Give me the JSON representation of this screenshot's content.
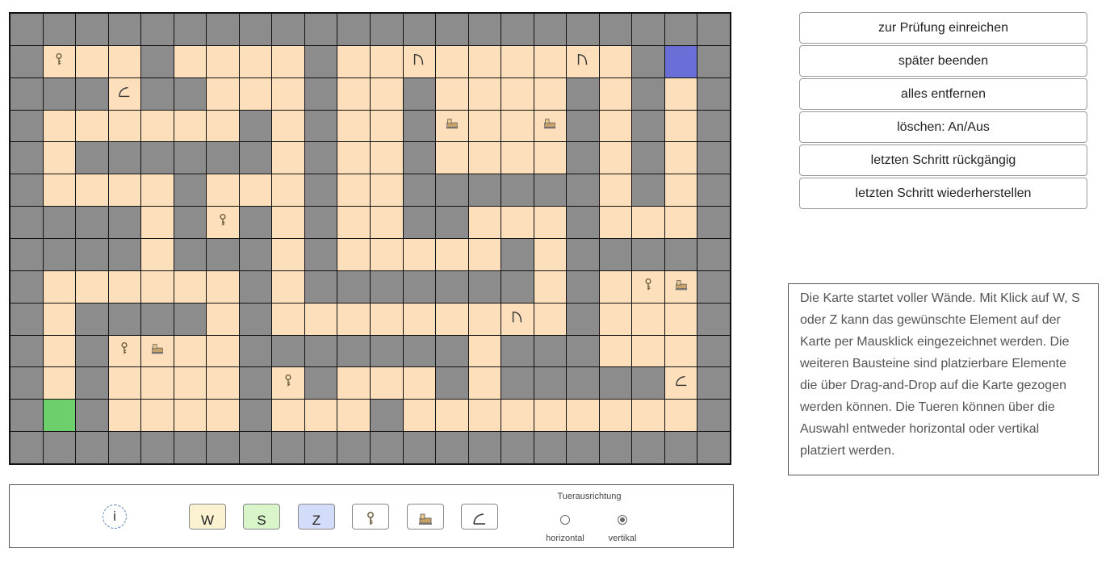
{
  "map": {
    "rows": [
      "WWWWWWWWWWWWWWWWWWWWWW",
      "WFFFWFFFFWFFFFFFFFFWZW",
      "WWWFWWFFFWFFWFFFFWFWFW",
      "WFFFFFFWFWFFWFFFFWFWFW",
      "WFWWWWWWFWFFWFFFFWFWFW",
      "WFFFFWFFFWFFWWWWWWFWFW",
      "WWWWFWFWFWFFWWFFFWFFFW",
      "WWWWFWWWFWFFFFFWFWWWWW",
      "WFFFFFFWFWWWWWWWFWFFFW",
      "WFWWWWFWFFFFFFFFFWFFFW",
      "WFWFFFFWWWWWWWFWWWFFFW",
      "WFWFFFFWFWFFFWFWWWWWFW",
      "WSWFFFFWFFFWFFFFFFFFFW",
      "WWWWWWWWWWWWWWWWWWWWWW"
    ],
    "items": [
      {
        "row": 1,
        "col": 1,
        "icon": "key-icon"
      },
      {
        "row": 1,
        "col": 12,
        "icon": "door-icon"
      },
      {
        "row": 1,
        "col": 17,
        "icon": "door-icon"
      },
      {
        "row": 2,
        "col": 3,
        "icon": "trap-icon"
      },
      {
        "row": 3,
        "col": 13,
        "icon": "sphinx-icon"
      },
      {
        "row": 3,
        "col": 16,
        "icon": "sphinx-icon"
      },
      {
        "row": 6,
        "col": 6,
        "icon": "key-icon"
      },
      {
        "row": 8,
        "col": 19,
        "icon": "key-icon"
      },
      {
        "row": 8,
        "col": 20,
        "icon": "sphinx-icon"
      },
      {
        "row": 9,
        "col": 15,
        "icon": "door-icon"
      },
      {
        "row": 10,
        "col": 3,
        "icon": "key-icon"
      },
      {
        "row": 10,
        "col": 4,
        "icon": "sphinx-icon"
      },
      {
        "row": 11,
        "col": 8,
        "icon": "key-icon"
      },
      {
        "row": 11,
        "col": 20,
        "icon": "trap-icon"
      }
    ],
    "colors": {
      "wall": "#8c8c8c",
      "floor": "#fde0bb",
      "start": "#6ccf6c",
      "goal": "#6a6fd8"
    }
  },
  "buttons": {
    "submit": "zur Prüfung einreichen",
    "later": "später beenden",
    "clear_all": "alles entfernen",
    "delete_toggle": "löschen: An/Aus",
    "undo": "letzten Schritt rückgängig",
    "redo": "letzten Schritt wiederherstellen"
  },
  "info_text": "Die Karte startet voller Wände. Mit Klick auf W, S oder Z kann das gewünschte Element auf der Karte per Mausklick eingezeichnet werden. Die weiteren Bausteine sind platzierbare Elemente die über Drag-and-Drop auf die Karte gezogen werden können. Die Tueren können über die Auswahl entweder horizontal oder vertikal platziert werden.",
  "toolbar": {
    "info_label": "i",
    "wall_label": "W",
    "start_label": "S",
    "goal_label": "Z",
    "tools": [
      "key-icon",
      "sphinx-icon",
      "trap-icon"
    ],
    "door_orientation_title": "Tuerausrichtung",
    "horizontal_label": "horizontal",
    "vertical_label": "vertikal",
    "selected_orientation": "vertikal"
  }
}
